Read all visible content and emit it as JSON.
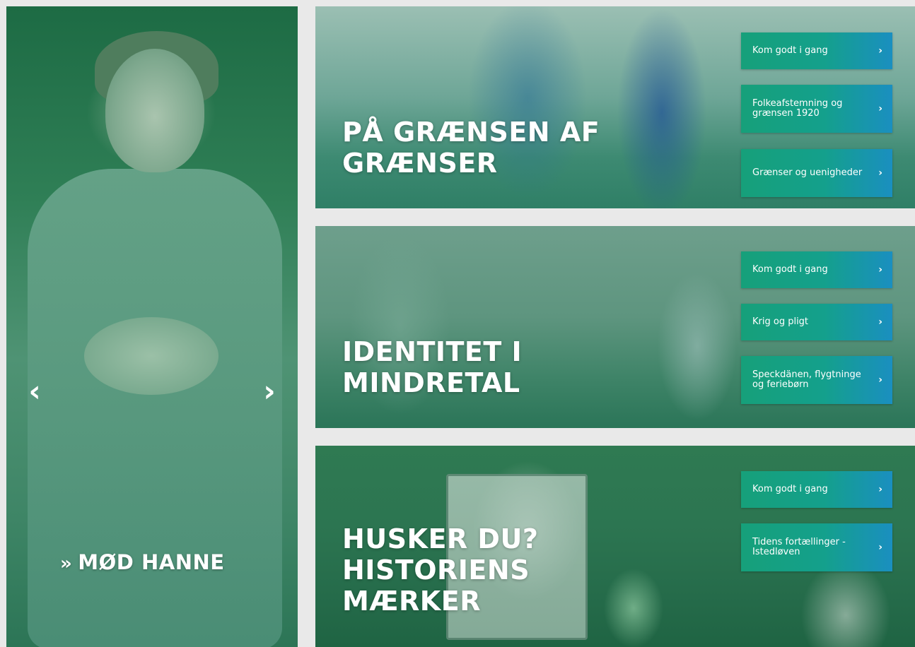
{
  "hero": {
    "prev_arrow": "‹",
    "next_arrow": "›",
    "link_chevron": "»",
    "link_label": "MØD HANNE"
  },
  "panels": [
    {
      "title_lines": [
        "PÅ GRÆNSEN AF",
        "GRÆNSER"
      ],
      "buttons": [
        {
          "label": "Kom godt i gang"
        },
        {
          "label": "Folkeafstemning og grænsen 1920"
        },
        {
          "label": "Grænser og uenigheder"
        }
      ]
    },
    {
      "title_lines": [
        "IDENTITET I",
        "MINDRETAL"
      ],
      "buttons": [
        {
          "label": "Kom godt i gang"
        },
        {
          "label": "Krig og pligt"
        },
        {
          "label": "Speckdänen, flygtninge og feriebørn"
        }
      ]
    },
    {
      "title_lines": [
        "HUSKER DU?",
        "HISTORIENS",
        "MÆRKER"
      ],
      "buttons": [
        {
          "label": "Kom godt i gang"
        },
        {
          "label": "Tidens fortællinger - Istedløven"
        }
      ]
    }
  ],
  "button_arrow": "›",
  "colors": {
    "button_start": "#16a07a",
    "button_end": "#1a8fc0",
    "background": "#e9e9e9",
    "text": "#ffffff"
  }
}
